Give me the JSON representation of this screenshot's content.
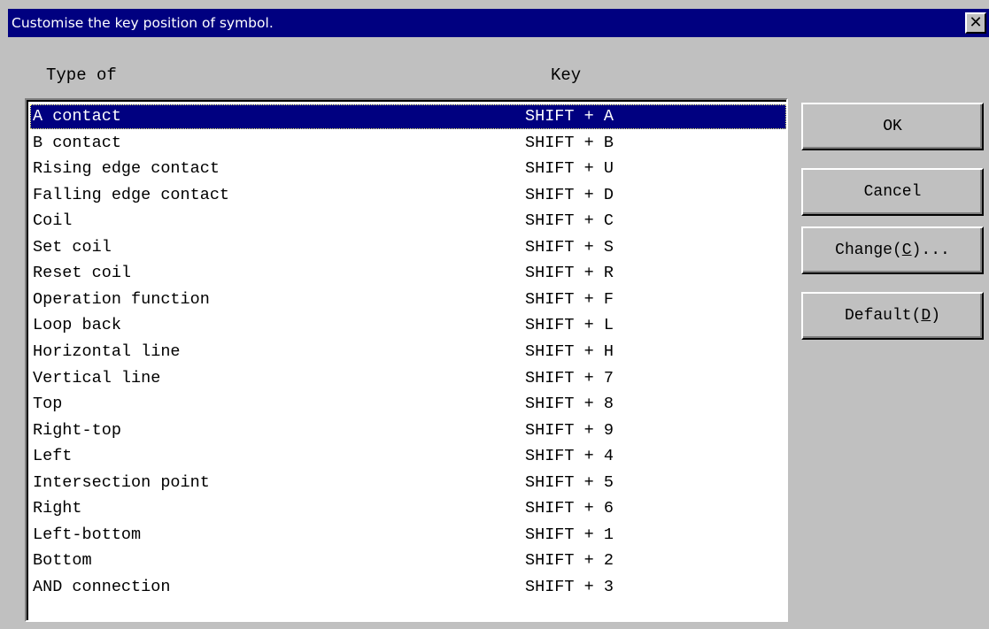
{
  "window": {
    "title": "Customise the key position of symbol.",
    "close_glyph": "✕"
  },
  "headers": {
    "type": "Type of",
    "key": "Key"
  },
  "rows": [
    {
      "type": "A contact",
      "key": "SHIFT + A"
    },
    {
      "type": "B contact",
      "key": "SHIFT + B"
    },
    {
      "type": "Rising edge contact",
      "key": "SHIFT + U"
    },
    {
      "type": "Falling edge contact",
      "key": "SHIFT + D"
    },
    {
      "type": "Coil",
      "key": "SHIFT + C"
    },
    {
      "type": "Set coil",
      "key": "SHIFT + S"
    },
    {
      "type": "Reset coil",
      "key": "SHIFT + R"
    },
    {
      "type": "Operation function",
      "key": "SHIFT + F"
    },
    {
      "type": "Loop back",
      "key": "SHIFT + L"
    },
    {
      "type": "Horizontal line",
      "key": "SHIFT + H"
    },
    {
      "type": "Vertical line",
      "key": "SHIFT + 7"
    },
    {
      "type": "Top",
      "key": "SHIFT + 8"
    },
    {
      "type": "Right-top",
      "key": "SHIFT + 9"
    },
    {
      "type": "Left",
      "key": "SHIFT + 4"
    },
    {
      "type": "Intersection point",
      "key": "SHIFT + 5"
    },
    {
      "type": "Right",
      "key": "SHIFT + 6"
    },
    {
      "type": "Left-bottom",
      "key": "SHIFT + 1"
    },
    {
      "type": "Bottom",
      "key": "SHIFT + 2"
    },
    {
      "type": "AND connection",
      "key": "SHIFT + 3"
    }
  ],
  "selected_row": "A contact",
  "buttons": {
    "ok": "OK",
    "cancel": "Cancel",
    "change_prefix": "Change(",
    "change_key": "C",
    "change_suffix": ")...",
    "default_prefix": "Default(",
    "default_key": "D",
    "default_suffix": ")"
  },
  "colors": {
    "titlebar": "#000080",
    "face": "#c0c0c0",
    "selection": "#000080",
    "list_bg": "#ffffff"
  }
}
